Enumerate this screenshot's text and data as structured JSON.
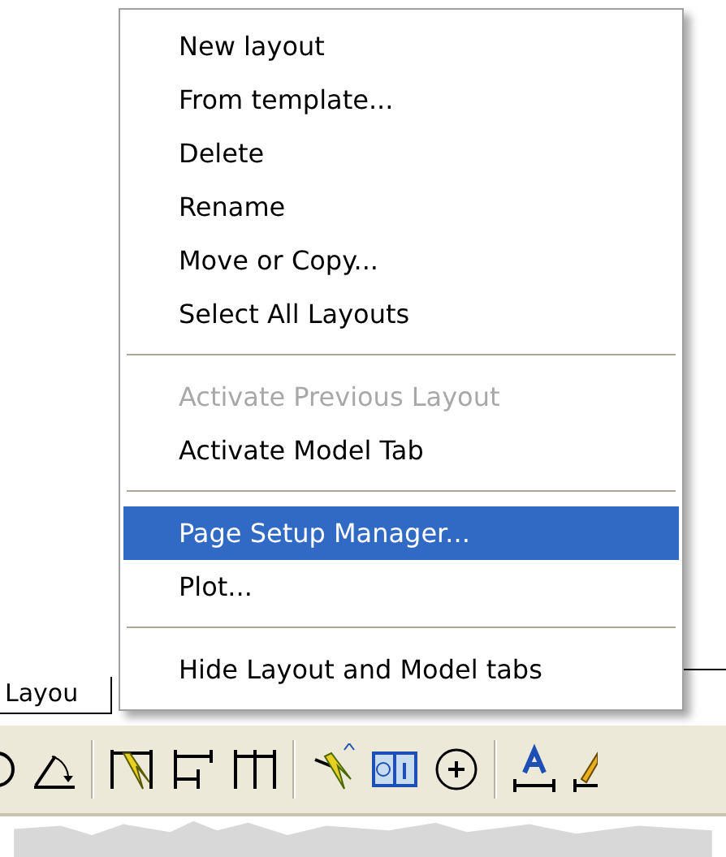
{
  "tab": {
    "label": "Layou"
  },
  "context_menu": {
    "items": [
      {
        "kind": "item",
        "label": "New layout",
        "disabled": false,
        "selected": false
      },
      {
        "kind": "item",
        "label": "From template...",
        "disabled": false,
        "selected": false
      },
      {
        "kind": "item",
        "label": "Delete",
        "disabled": false,
        "selected": false
      },
      {
        "kind": "item",
        "label": "Rename",
        "disabled": false,
        "selected": false
      },
      {
        "kind": "item",
        "label": "Move or Copy...",
        "disabled": false,
        "selected": false
      },
      {
        "kind": "item",
        "label": "Select All Layouts",
        "disabled": false,
        "selected": false
      },
      {
        "kind": "separator"
      },
      {
        "kind": "item",
        "label": "Activate Previous Layout",
        "disabled": true,
        "selected": false
      },
      {
        "kind": "item",
        "label": "Activate Model Tab",
        "disabled": false,
        "selected": false
      },
      {
        "kind": "separator"
      },
      {
        "kind": "item",
        "label": "Page Setup Manager...",
        "disabled": false,
        "selected": true
      },
      {
        "kind": "item",
        "label": "Plot...",
        "disabled": false,
        "selected": false
      },
      {
        "kind": "separator"
      },
      {
        "kind": "item",
        "label": "Hide Layout and Model tabs",
        "disabled": false,
        "selected": false
      }
    ]
  }
}
